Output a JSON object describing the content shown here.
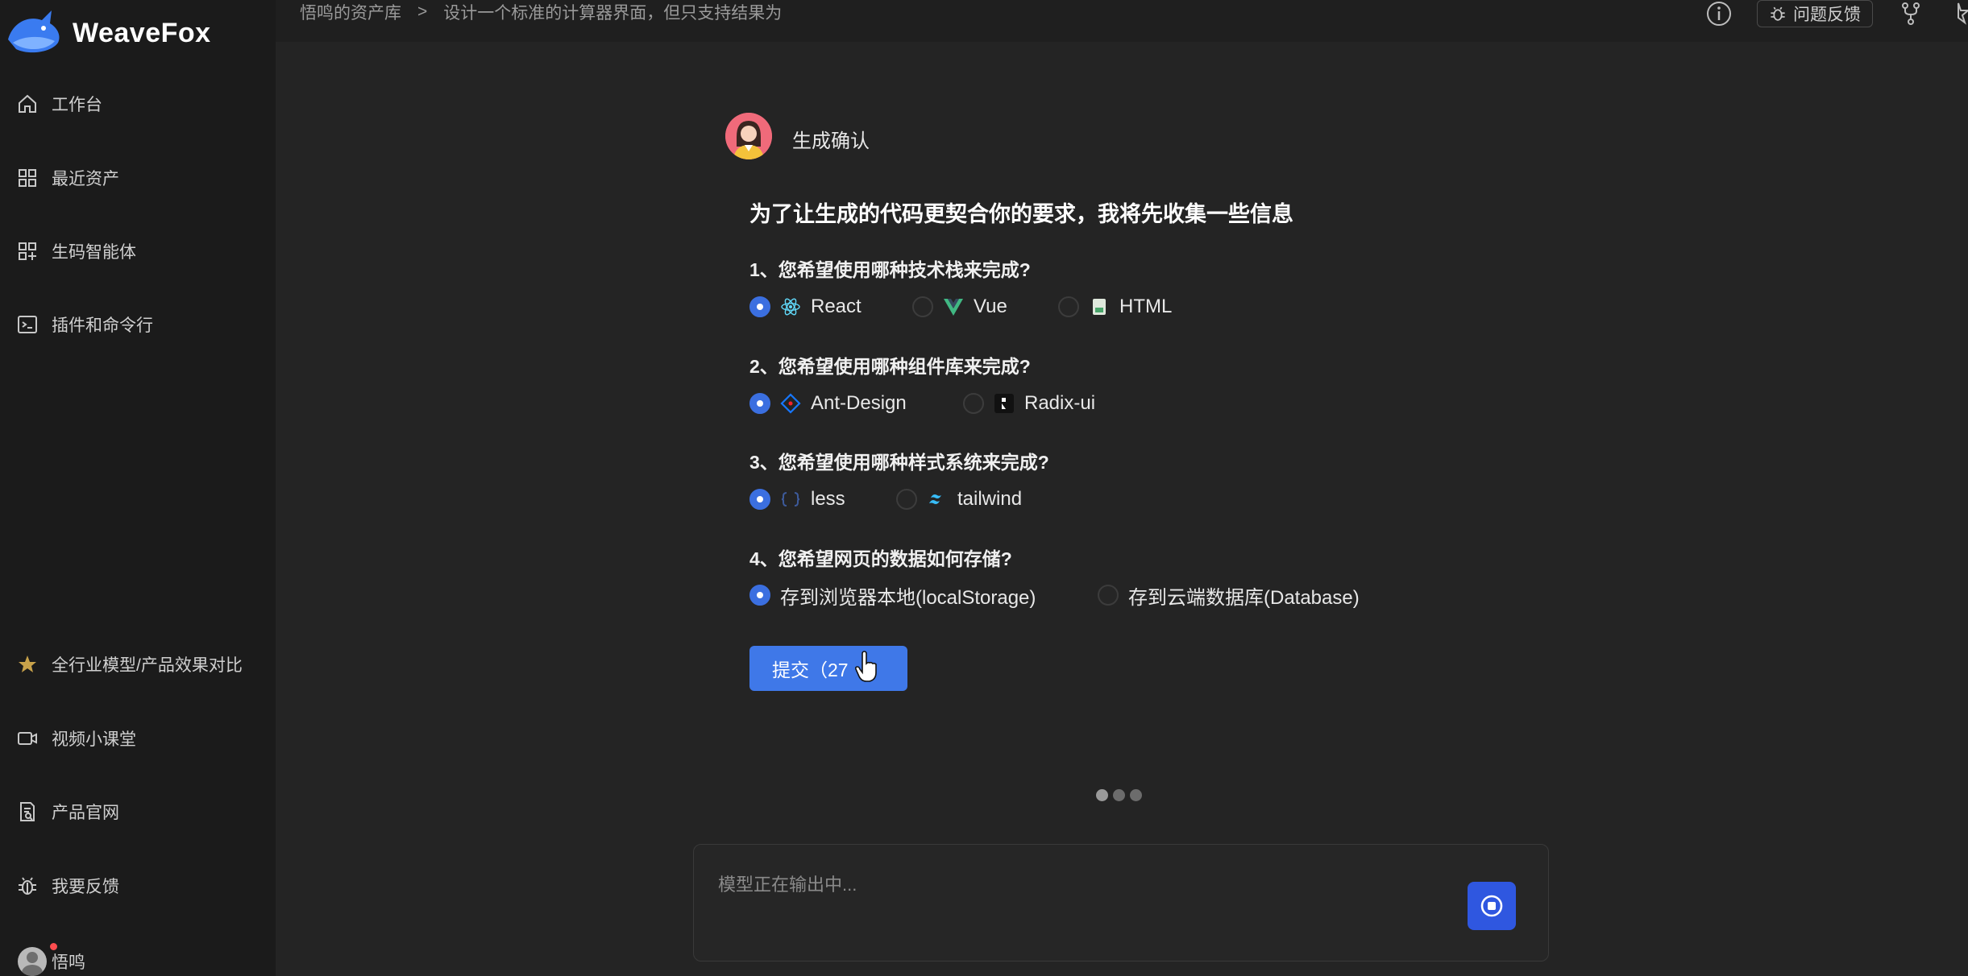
{
  "app": {
    "name": "WeaveFox"
  },
  "sidebar": {
    "top_items": [
      {
        "label": "工作台",
        "icon": "home-icon"
      },
      {
        "label": "最近资产",
        "icon": "grid-icon"
      },
      {
        "label": "生码智能体",
        "icon": "agent-grid-icon"
      },
      {
        "label": "插件和命令行",
        "icon": "terminal-icon"
      }
    ],
    "bottom_items": [
      {
        "label": "全行业模型/产品效果对比",
        "icon": "star-icon"
      },
      {
        "label": "视频小课堂",
        "icon": "video-icon"
      },
      {
        "label": "产品官网",
        "icon": "document-search-icon"
      },
      {
        "label": "我要反馈",
        "icon": "bug-icon"
      }
    ],
    "user": {
      "name": "悟鸣"
    }
  },
  "topbar": {
    "breadcrumb": [
      "悟鸣的资产库",
      ">",
      "设计一个标准的计算器界面，但只支持结果为"
    ],
    "feedback_label": "问题反馈"
  },
  "chat": {
    "bot_name": "生成确认",
    "headline": "为了让生成的代码更契合你的要求，我将先收集一些信息",
    "questions": [
      {
        "text": "1、您希望使用哪种技术栈来完成?",
        "options": [
          {
            "label": "React",
            "icon": "react-icon",
            "checked": true
          },
          {
            "label": "Vue",
            "icon": "vue-icon",
            "checked": false
          },
          {
            "label": "HTML",
            "icon": "html-icon",
            "checked": false
          }
        ]
      },
      {
        "text": "2、您希望使用哪种组件库来完成?",
        "options": [
          {
            "label": "Ant-Design",
            "icon": "ant-design-icon",
            "checked": true
          },
          {
            "label": "Radix-ui",
            "icon": "radix-icon",
            "checked": false
          }
        ]
      },
      {
        "text": "3、您希望使用哪种样式系统来完成?",
        "options": [
          {
            "label": "less",
            "icon": "less-icon",
            "checked": true
          },
          {
            "label": "tailwind",
            "icon": "tailwind-icon",
            "checked": false
          }
        ]
      },
      {
        "text": "4、您希望网页的数据如何存储?",
        "options": [
          {
            "label": "存到浏览器本地(localStorage)",
            "checked": true
          },
          {
            "label": "存到云端数据库(Database)",
            "checked": false
          }
        ]
      }
    ],
    "submit_label": "提交（27"
  },
  "input": {
    "placeholder": "模型正在输出中..."
  },
  "colors": {
    "accent": "#3f78e8",
    "sidebar_bg": "#1b1b1b",
    "content_bg": "#242424"
  }
}
